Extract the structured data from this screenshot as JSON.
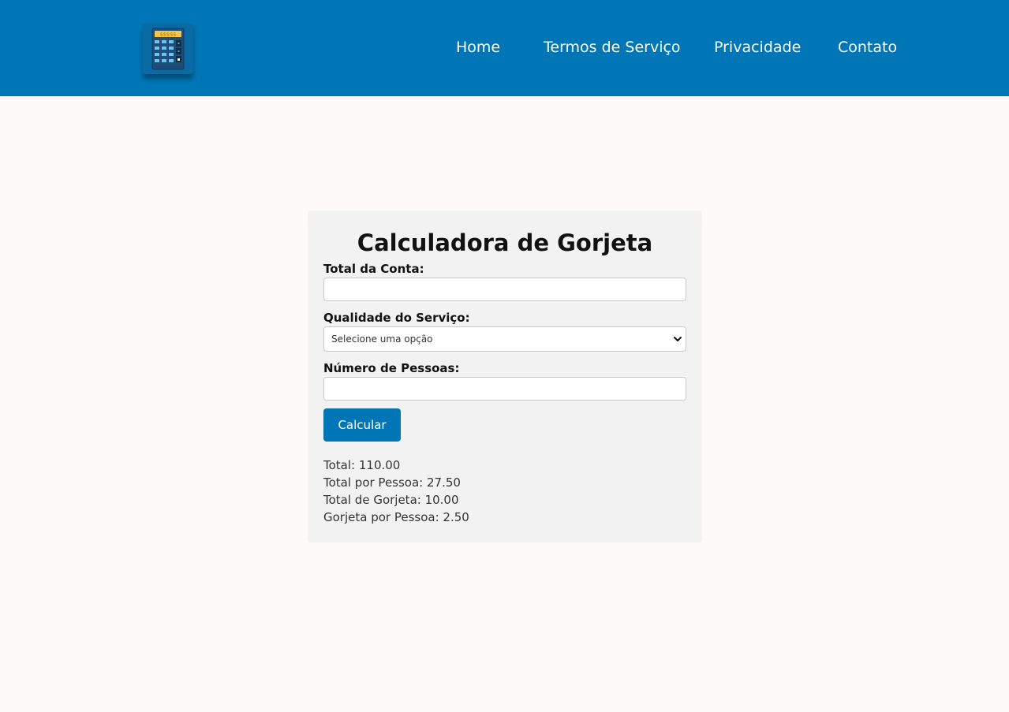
{
  "header": {
    "logo_icon": "calculator-icon",
    "logo_text": "$$$$$",
    "nav": [
      {
        "label": "Home"
      },
      {
        "label": "Termos de Serviço"
      },
      {
        "label": "Privacidade"
      },
      {
        "label": "Contato"
      }
    ],
    "background_color": "#0076b6"
  },
  "calculator": {
    "title": "Calculadora de Gorjeta",
    "bill_label": "Total da Conta:",
    "bill_value": "",
    "service_label": "Qualidade do Serviço:",
    "service_selected": "Selecione uma opção",
    "people_label": "Número de Pessoas:",
    "people_value": "",
    "button_label": "Calcular",
    "results": [
      "Total: 110.00",
      "Total por Pessoa: 27.50",
      "Total de Gorjeta: 10.00",
      "Gorjeta por Pessoa: 2.50"
    ]
  },
  "colors": {
    "accent": "#0076b6",
    "page_background": "#fdfaf9",
    "card_background": "#f2f2f2"
  }
}
